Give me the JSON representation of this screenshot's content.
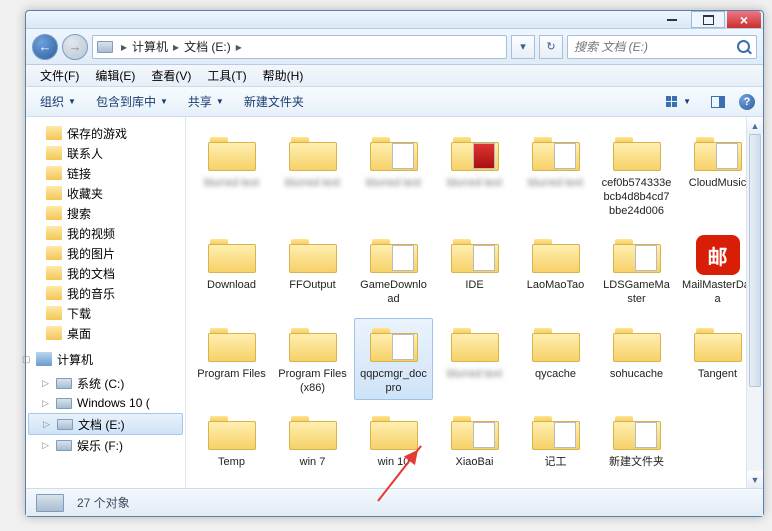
{
  "titlebar": {
    "close": "×"
  },
  "nav": {
    "back_glyph": "←",
    "fwd_glyph": "→",
    "drop_glyph": "▾",
    "refresh_glyph": "↻",
    "crumbs": {
      "root": "计算机",
      "drive": "文档 (E:)",
      "sep": "▸",
      "tail": "▸"
    }
  },
  "search": {
    "placeholder": "搜索 文档 (E:)"
  },
  "menu": {
    "file": "文件(F)",
    "edit": "编辑(E)",
    "view": "查看(V)",
    "tools": "工具(T)",
    "help": "帮助(H)"
  },
  "toolbar": {
    "organize": "组织",
    "include": "包含到库中",
    "share": "共享",
    "newfolder": "新建文件夹",
    "help": "?"
  },
  "tree": {
    "nodes": [
      {
        "label": "保存的游戏",
        "type": "fav"
      },
      {
        "label": "联系人",
        "type": "fav"
      },
      {
        "label": "链接",
        "type": "fav"
      },
      {
        "label": "收藏夹",
        "type": "fav"
      },
      {
        "label": "搜索",
        "type": "fav"
      },
      {
        "label": "我的视频",
        "type": "fav"
      },
      {
        "label": "我的图片",
        "type": "fav"
      },
      {
        "label": "我的文档",
        "type": "fav"
      },
      {
        "label": "我的音乐",
        "type": "fav"
      },
      {
        "label": "下载",
        "type": "fav"
      },
      {
        "label": "桌面",
        "type": "fav"
      }
    ],
    "computer": "计算机",
    "drives": [
      {
        "label": "系统 (C:)",
        "sel": false
      },
      {
        "label": "Windows 10 (",
        "sel": false
      },
      {
        "label": "文档 (E:)",
        "sel": true
      },
      {
        "label": "娱乐 (F:)",
        "sel": false
      }
    ]
  },
  "rows": [
    [
      {
        "label": "",
        "blur": true,
        "ov": ""
      },
      {
        "label": "",
        "blur": true,
        "ov": ""
      },
      {
        "label": "",
        "blur": true,
        "ov": "doc"
      },
      {
        "label": "",
        "blur": true,
        "ov": "red"
      },
      {
        "label": "",
        "blur": true,
        "ov": "doc"
      },
      {
        "label": "cef0b574333ebcb4d8b4cd7bbe24d006"
      },
      {
        "label": "CloudMusic",
        "ov": "doc"
      }
    ],
    [
      {
        "label": "Download"
      },
      {
        "label": "FFOutput"
      },
      {
        "label": "GameDownload",
        "ov": "doc"
      },
      {
        "label": "IDE",
        "ov": "doc"
      },
      {
        "label": "LaoMaoTao"
      },
      {
        "label": "LDSGameMaster",
        "ov": "doc"
      },
      {
        "label": "MailMasterData",
        "type": "app",
        "glyph": "邮"
      }
    ],
    [
      {
        "label": "Program Files"
      },
      {
        "label": "Program Files (x86)"
      },
      {
        "label": "qqpcmgr_docpro",
        "sel": true,
        "ov": "doc"
      },
      {
        "label": "",
        "blur": true
      },
      {
        "label": "qycache"
      },
      {
        "label": "sohucache"
      },
      {
        "label": "Tangent"
      }
    ],
    [
      {
        "label": "Temp"
      },
      {
        "label": "win 7"
      },
      {
        "label": "win 10"
      },
      {
        "label": "XiaoBai",
        "ov": "doc"
      },
      {
        "label": "记工",
        "ov": "doc"
      },
      {
        "label": "新建文件夹",
        "ov": "doc"
      },
      null
    ]
  ],
  "status": {
    "count": "27 个对象"
  }
}
